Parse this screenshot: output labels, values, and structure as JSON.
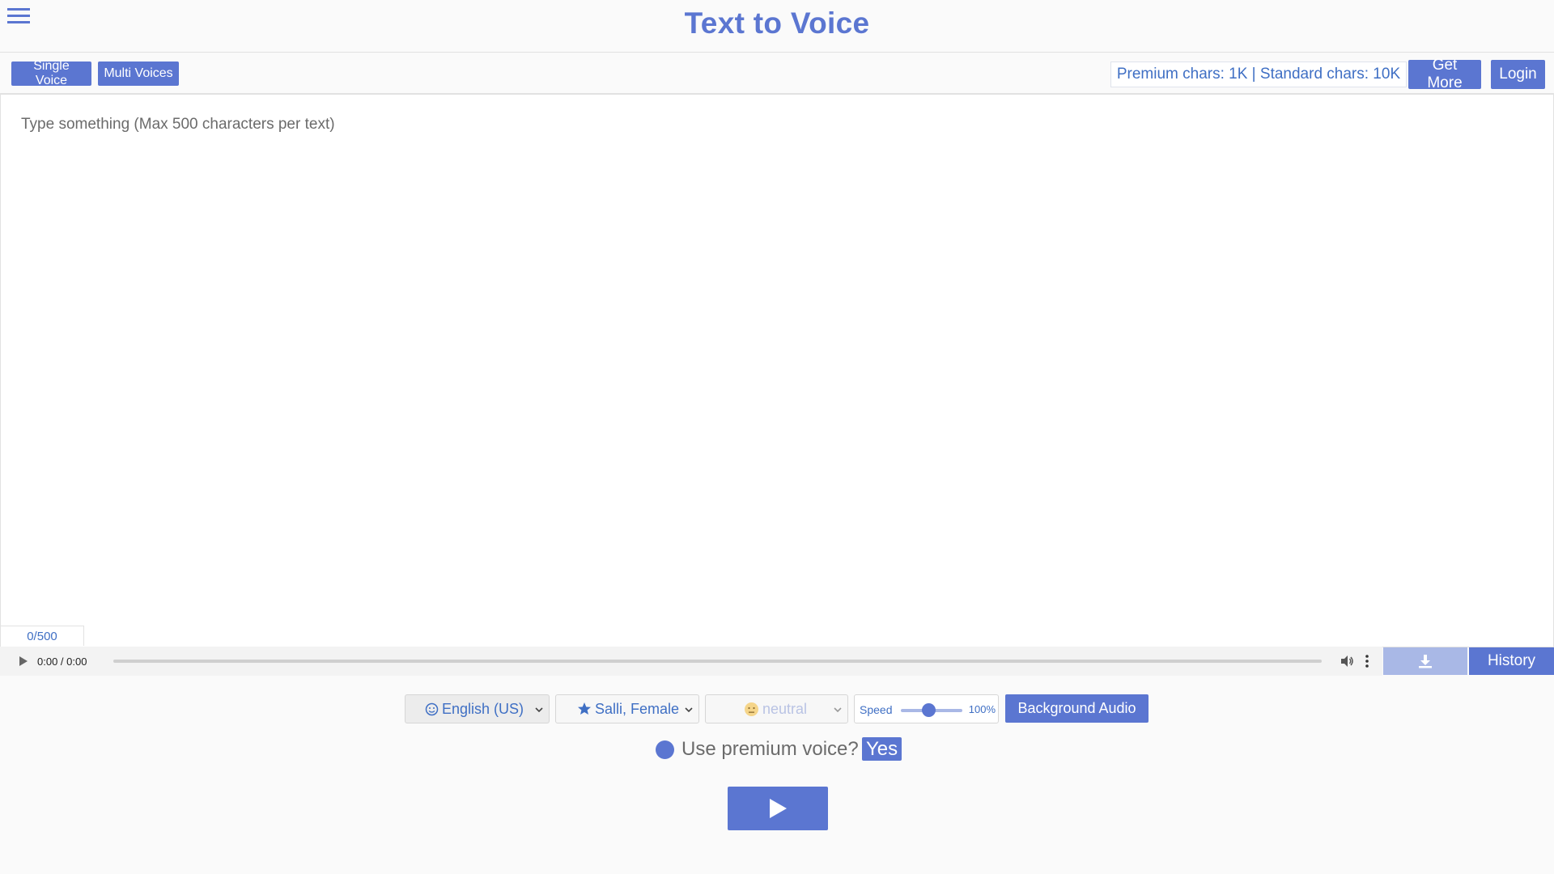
{
  "header": {
    "title": "Text to Voice"
  },
  "toolbar": {
    "single_voice_label": "Single Voice",
    "multi_voices_label": "Multi Voices",
    "credits_text": "Premium chars: 1K | Standard chars: 10K",
    "get_more_label": "Get More",
    "login_label": "Login"
  },
  "editor": {
    "placeholder": "Type something (Max 500 characters per text)",
    "value": "",
    "counter": "0/500"
  },
  "player": {
    "time": "0:00 / 0:00",
    "history_label": "History"
  },
  "controls": {
    "language": "English (US)",
    "voice": "Salli, Female",
    "mood": "neutral",
    "speed_label": "Speed",
    "speed_value": "100%",
    "background_audio_label": "Background Audio"
  },
  "premium": {
    "question": "Use premium voice?",
    "answer": "Yes"
  },
  "colors": {
    "accent": "#5b76d1",
    "accent_light": "#a9b8e6",
    "text_link": "#3f6fc4"
  },
  "icons": {
    "menu": "hamburger-icon",
    "play": "play-icon",
    "volume": "volume-icon",
    "more": "more-vertical-icon",
    "download": "download-icon",
    "language": "smiley-icon",
    "voice": "star-icon",
    "mood": "neutral-face-icon"
  }
}
